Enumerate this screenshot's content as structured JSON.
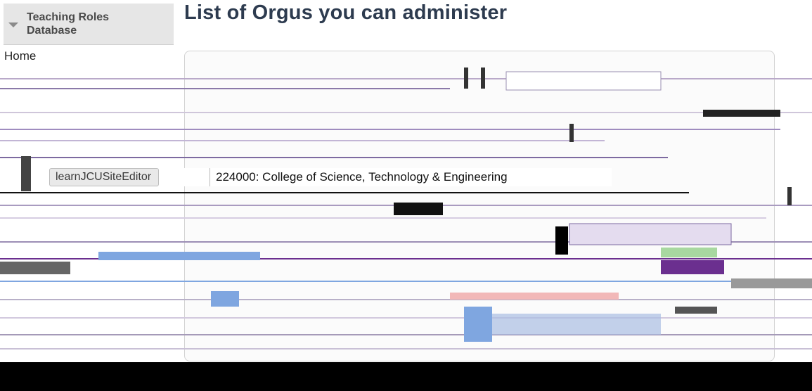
{
  "sidebar": {
    "title": "Teaching Roles Database",
    "items": [
      {
        "label": "Home"
      }
    ]
  },
  "page": {
    "title": "List of Orgus you can administer"
  },
  "roles": [
    {
      "role": "learnJCUSiteEditor",
      "org": "224000: College of Science, Technology & Engineering"
    }
  ],
  "colors": {
    "title": "#2d3b4f",
    "sidebar_header_bg": "#e6e6e6",
    "glitch_blue": "#7fa6e0",
    "glitch_green": "#a8d8a0",
    "glitch_purple": "#6b2f8f"
  }
}
